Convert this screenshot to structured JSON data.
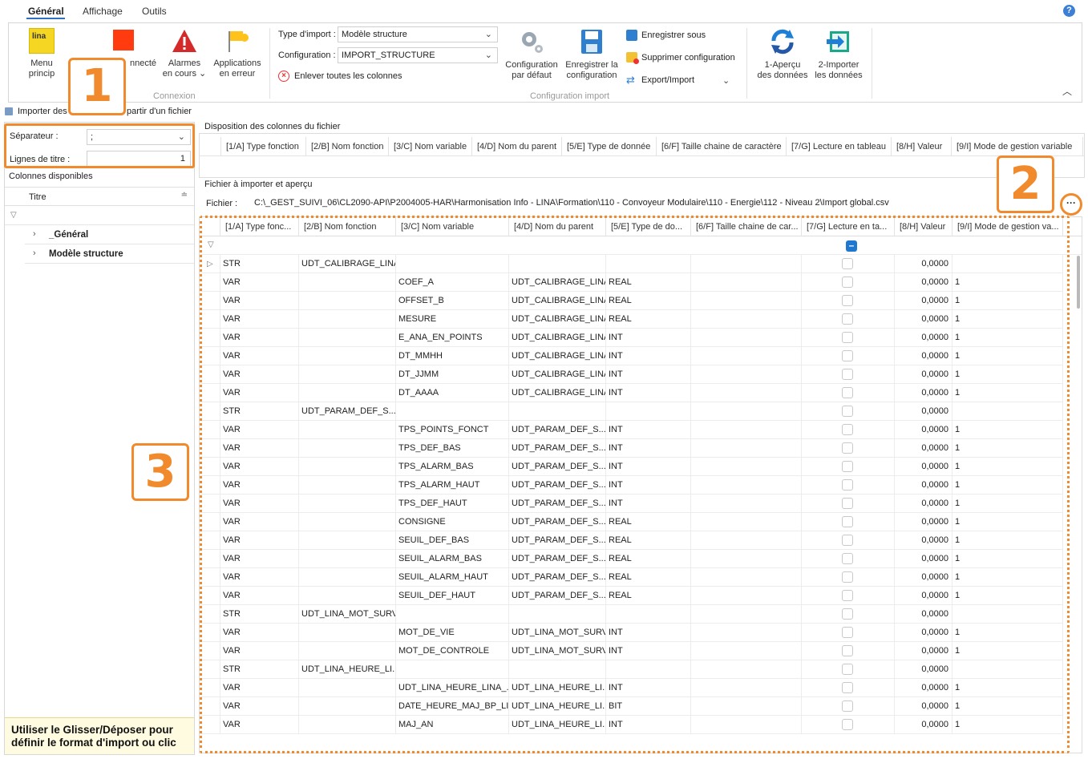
{
  "menu": {
    "tabs": [
      "Général",
      "Affichage",
      "Outils"
    ],
    "help": "?"
  },
  "ribbon": {
    "menu_principal": "Menu princip",
    "connecte": "nnecté",
    "alarmes": [
      "Alarmes",
      "en cours ⌄"
    ],
    "applications": [
      "Applications",
      "en erreur"
    ],
    "connexion_group": "Connexion",
    "type_import_label": "Type d'import :",
    "type_import_value": "Modèle structure",
    "configuration_label": "Configuration :",
    "configuration_value": "IMPORT_STRUCTURE",
    "enlever": "Enlever toutes les colonnes",
    "config_defaut": [
      "Configuration",
      "par défaut"
    ],
    "enregistrer_config": [
      "Enregistrer la",
      "configuration"
    ],
    "enregistrer_sous": "Enregistrer sous",
    "supprimer_config": "Supprimer configuration",
    "export_import": "Export/Import",
    "config_import_group": "Configuration import",
    "apercu": [
      "1-Aperçu",
      "des données"
    ],
    "importer": [
      "2-Importer",
      "les données"
    ]
  },
  "toolbar2": {
    "importer_des": "Importer des",
    "partir": "partir d'un fichier"
  },
  "left": {
    "separateur_label": "Séparateur :",
    "separateur_value": ";",
    "lignes_label": "Lignes de titre :",
    "lignes_value": "1",
    "colonnes_disponibles": "Colonnes disponibles",
    "titre_header": "Titre",
    "tree": [
      "_Général",
      "Modèle structure"
    ],
    "hint": "Utiliser le Glisser/Déposer pour définir le format d'import ou clic"
  },
  "disposition": {
    "title": "Disposition des colonnes du fichier",
    "columns": [
      "[1/A] Type fonction",
      "[2/B] Nom fonction",
      "[3/C] Nom variable",
      "[4/D] Nom du parent",
      "[5/E] Type de donnée",
      "[6/F] Taille chaine de caractère",
      "[7/G] Lecture en tableau",
      "[8/H] Valeur",
      "[9/I] Mode de gestion variable"
    ]
  },
  "fichier": {
    "title": "Fichier à importer et aperçu",
    "label": "Fichier :",
    "path": "C:\\_GEST_SUIVI_06\\CL2090-API\\P2004005-HAR\\Harmonisation Info - LINA\\Formation\\110 - Convoyeur Modulaire\\110 - Energie\\112 - Niveau 2\\Import global.csv",
    "browse": "···"
  },
  "grid": {
    "headers": [
      "[1/A] Type fonc...",
      "[2/B] Nom fonction",
      "[3/C] Nom variable",
      "[4/D] Nom du parent",
      "[5/E] Type de do...",
      "[6/F] Taille chaine de car...",
      "[7/G] Lecture en ta...",
      "[8/H] Valeur",
      "[9/I] Mode de gestion va..."
    ],
    "rows": [
      [
        "STR",
        "UDT_CALIBRAGE_LINA",
        "",
        "",
        "",
        "",
        "",
        "0,0000",
        ""
      ],
      [
        "VAR",
        "",
        "COEF_A",
        "UDT_CALIBRAGE_LINA",
        "REAL",
        "",
        "",
        "0,0000",
        "1"
      ],
      [
        "VAR",
        "",
        "OFFSET_B",
        "UDT_CALIBRAGE_LINA",
        "REAL",
        "",
        "",
        "0,0000",
        "1"
      ],
      [
        "VAR",
        "",
        "MESURE",
        "UDT_CALIBRAGE_LINA",
        "REAL",
        "",
        "",
        "0,0000",
        "1"
      ],
      [
        "VAR",
        "",
        "E_ANA_EN_POINTS",
        "UDT_CALIBRAGE_LINA",
        "INT",
        "",
        "",
        "0,0000",
        "1"
      ],
      [
        "VAR",
        "",
        "DT_MMHH",
        "UDT_CALIBRAGE_LINA",
        "INT",
        "",
        "",
        "0,0000",
        "1"
      ],
      [
        "VAR",
        "",
        "DT_JJMM",
        "UDT_CALIBRAGE_LINA",
        "INT",
        "",
        "",
        "0,0000",
        "1"
      ],
      [
        "VAR",
        "",
        "DT_AAAA",
        "UDT_CALIBRAGE_LINA",
        "INT",
        "",
        "",
        "0,0000",
        "1"
      ],
      [
        "STR",
        "UDT_PARAM_DEF_S...",
        "",
        "",
        "",
        "",
        "",
        "0,0000",
        ""
      ],
      [
        "VAR",
        "",
        "TPS_POINTS_FONCT",
        "UDT_PARAM_DEF_S...",
        "INT",
        "",
        "",
        "0,0000",
        "1"
      ],
      [
        "VAR",
        "",
        "TPS_DEF_BAS",
        "UDT_PARAM_DEF_S...",
        "INT",
        "",
        "",
        "0,0000",
        "1"
      ],
      [
        "VAR",
        "",
        "TPS_ALARM_BAS",
        "UDT_PARAM_DEF_S...",
        "INT",
        "",
        "",
        "0,0000",
        "1"
      ],
      [
        "VAR",
        "",
        "TPS_ALARM_HAUT",
        "UDT_PARAM_DEF_S...",
        "INT",
        "",
        "",
        "0,0000",
        "1"
      ],
      [
        "VAR",
        "",
        "TPS_DEF_HAUT",
        "UDT_PARAM_DEF_S...",
        "INT",
        "",
        "",
        "0,0000",
        "1"
      ],
      [
        "VAR",
        "",
        "CONSIGNE",
        "UDT_PARAM_DEF_S...",
        "REAL",
        "",
        "",
        "0,0000",
        "1"
      ],
      [
        "VAR",
        "",
        "SEUIL_DEF_BAS",
        "UDT_PARAM_DEF_S...",
        "REAL",
        "",
        "",
        "0,0000",
        "1"
      ],
      [
        "VAR",
        "",
        "SEUIL_ALARM_BAS",
        "UDT_PARAM_DEF_S...",
        "REAL",
        "",
        "",
        "0,0000",
        "1"
      ],
      [
        "VAR",
        "",
        "SEUIL_ALARM_HAUT",
        "UDT_PARAM_DEF_S...",
        "REAL",
        "",
        "",
        "0,0000",
        "1"
      ],
      [
        "VAR",
        "",
        "SEUIL_DEF_HAUT",
        "UDT_PARAM_DEF_S...",
        "REAL",
        "",
        "",
        "0,0000",
        "1"
      ],
      [
        "STR",
        "UDT_LINA_MOT_SURV",
        "",
        "",
        "",
        "",
        "",
        "0,0000",
        ""
      ],
      [
        "VAR",
        "",
        "MOT_DE_VIE",
        "UDT_LINA_MOT_SURV",
        "INT",
        "",
        "",
        "0,0000",
        "1"
      ],
      [
        "VAR",
        "",
        "MOT_DE_CONTROLE",
        "UDT_LINA_MOT_SURV",
        "INT",
        "",
        "",
        "0,0000",
        "1"
      ],
      [
        "STR",
        "UDT_LINA_HEURE_LI...",
        "",
        "",
        "",
        "",
        "",
        "0,0000",
        ""
      ],
      [
        "VAR",
        "",
        "UDT_LINA_HEURE_LINA_...",
        "UDT_LINA_HEURE_LI...",
        "INT",
        "",
        "",
        "0,0000",
        "1"
      ],
      [
        "VAR",
        "",
        "DATE_HEURE_MAJ_BP_LI...",
        "UDT_LINA_HEURE_LI...",
        "BIT",
        "",
        "",
        "0,0000",
        "1"
      ],
      [
        "VAR",
        "",
        "MAJ_AN",
        "UDT_LINA_HEURE_LI...",
        "INT",
        "",
        "",
        "0,0000",
        "1"
      ]
    ]
  },
  "callouts": [
    "1",
    "2",
    "3"
  ]
}
